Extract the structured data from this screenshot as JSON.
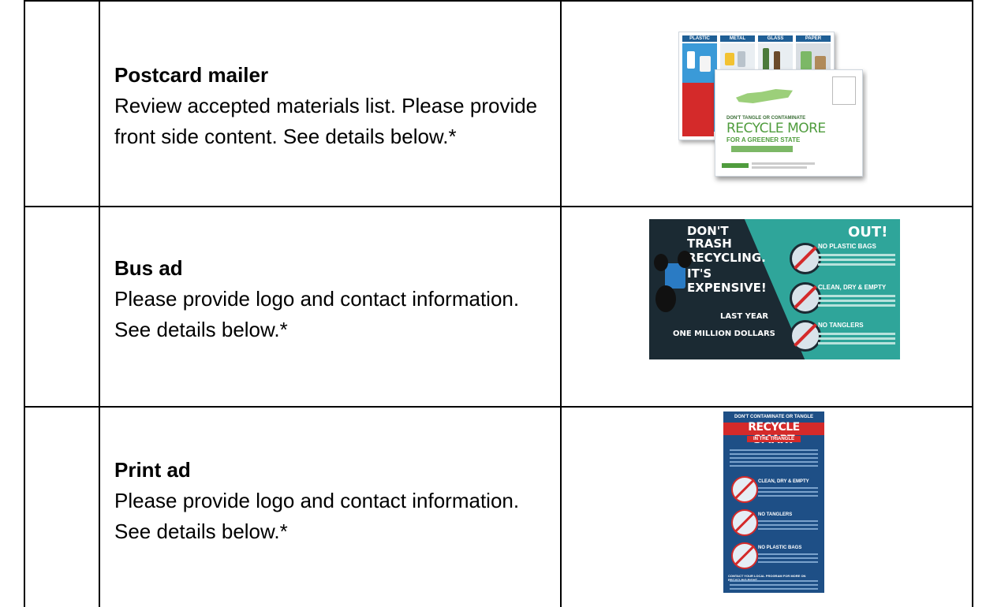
{
  "rows": [
    {
      "title": "Postcard mailer",
      "description": "Review accepted materials list. Please provide front side content. See details below.*",
      "thumbnail": {
        "back_headers": [
          "PLASTIC",
          "METAL",
          "GLASS",
          "PAPER"
        ],
        "front_line1": "DON'T TANGLE OR CONTAMINATE",
        "front_headline": "RECYCLE MORE",
        "front_subline": "FOR A GREENER STATE"
      }
    },
    {
      "title": "Bus ad",
      "description": "Please provide logo and contact information. See details below.*",
      "thumbnail": {
        "headline": [
          "DON'T",
          "TRASH",
          "RECYCLING.",
          "IT'S",
          "EXPENSIVE!"
        ],
        "out": "OUT!",
        "items": [
          "NO PLASTIC BAGS",
          "CLEAN, DRY & EMPTY",
          "NO TANGLERS"
        ],
        "last_year": "LAST YEAR",
        "amount": "ONE MILLION DOLLARS"
      }
    },
    {
      "title": "Print ad",
      "description": "Please provide logo and contact information. See details below.*",
      "thumbnail": {
        "top": "DON'T CONTAMINATE OR TANGLE",
        "headline": "RECYCLE SMART",
        "sub": "IN THE TRIANGLE",
        "items": [
          "CLEAN, DRY & EMPTY",
          "NO TANGLERS",
          "NO PLASTIC BAGS"
        ],
        "footer": "CONTACT YOUR LOCAL PROGRAM FOR MORE ON RECYCLING RIGHT"
      }
    }
  ],
  "colors": {
    "border": "#000000",
    "bus_teal": "#2fa59a",
    "print_blue": "#1e4f86",
    "accent_red": "#d42a2a"
  }
}
